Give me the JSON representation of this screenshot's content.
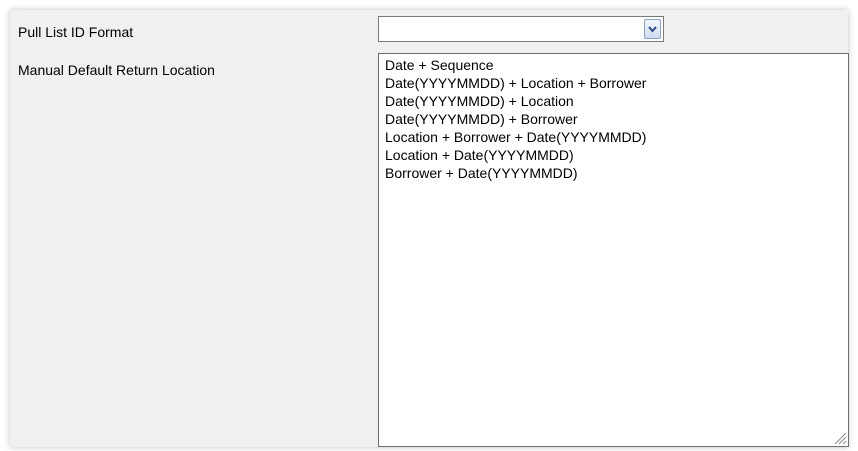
{
  "form": {
    "pull_list_label": "Pull List ID Format",
    "manual_default_label": "Manual Default Return Location"
  },
  "combo": {
    "value": "",
    "icon": "chevron-down-icon"
  },
  "listbox": {
    "items": [
      "Date + Sequence",
      "Date(YYYYMMDD) + Location + Borrower",
      "Date(YYYYMMDD) + Location",
      "Date(YYYYMMDD) + Borrower",
      "Location + Borrower + Date(YYYYMMDD)",
      "Location + Date(YYYYMMDD)",
      "Borrower + Date(YYYYMMDD)"
    ],
    "resize_icon": "resize-grip-icon"
  },
  "colors": {
    "panel_background": "#f0f0f0",
    "combo_button": "#cfdcf0",
    "arrow": "#2a4a8a"
  }
}
